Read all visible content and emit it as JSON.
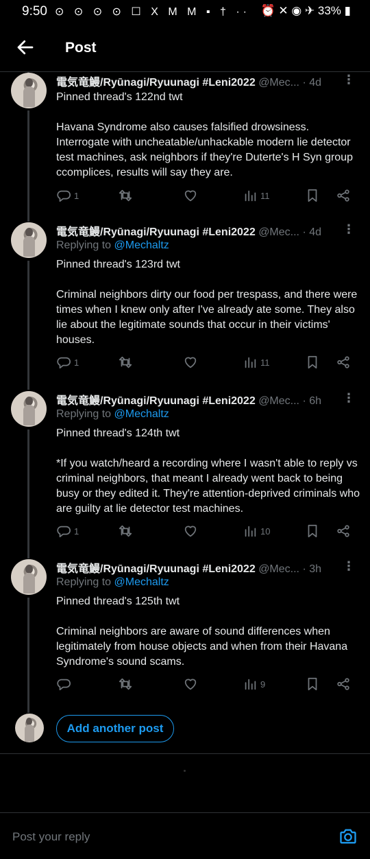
{
  "status_bar": {
    "time": "9:50",
    "icons": "⊙ ⊙ ⊙ ⊙ ☐ X M M ▪ †  ··",
    "right": "⏰ ✕ ◉ ✈ 33% ▮"
  },
  "header": {
    "title": "Post",
    "back_icon": "arrow-left-icon"
  },
  "posts": [
    {
      "name": "電気竜鰻/Ryūnagi/Ryuunagi #Leni2022",
      "handle": "@Mec...",
      "time": "· 4d",
      "replying_prefix": "",
      "replying_handle": "",
      "text": "Pinned thread's 122nd twt\n\nHavana Syndrome also causes falsified drowsiness. Interrogate with uncheatable/unhackable modern lie detector test machines, ask neighbors if they're Duterte's H Syn group ccomplices, results will say they are.",
      "replies": "1",
      "retweets": "",
      "likes": "",
      "views": "11"
    },
    {
      "name": "電気竜鰻/Ryūnagi/Ryuunagi #Leni2022",
      "handle": "@Mec...",
      "time": "· 4d",
      "replying_prefix": "Replying to ",
      "replying_handle": "@Mechaltz",
      "text": "Pinned thread's 123rd twt\n\nCriminal neighbors dirty our food per trespass, and there were times when I knew only after I've already ate some. They also lie about the legitimate sounds that occur in their victims' houses.",
      "replies": "1",
      "retweets": "",
      "likes": "",
      "views": "11"
    },
    {
      "name": "電気竜鰻/Ryūnagi/Ryuunagi #Leni2022",
      "handle": "@Mec...",
      "time": "· 6h",
      "replying_prefix": "Replying to ",
      "replying_handle": "@Mechaltz",
      "text": "Pinned thread's 124th twt\n\n*If you watch/heard a recording where I wasn't able to reply vs criminal neighbors, that meant I already went back to being busy or they edited it. They're attention-deprived criminals who are guilty at lie detector test machines.",
      "replies": "1",
      "retweets": "",
      "likes": "",
      "views": "10"
    },
    {
      "name": "電気竜鰻/Ryūnagi/Ryuunagi #Leni2022",
      "handle": "@Mec...",
      "time": "· 3h",
      "replying_prefix": "Replying to ",
      "replying_handle": "@Mechaltz",
      "text": "Pinned thread's 125th twt\n\nCriminal neighbors are aware of sound differences when legitimately from house objects and when from their Havana Syndrome's sound scams.",
      "replies": "",
      "retweets": "",
      "likes": "",
      "views": "9"
    }
  ],
  "add_post_label": "Add another post",
  "reply_placeholder": "Post your reply",
  "colors": {
    "accent": "#1d9bf0",
    "background": "#000000",
    "muted": "#71767b",
    "text": "#e7e9ea"
  }
}
